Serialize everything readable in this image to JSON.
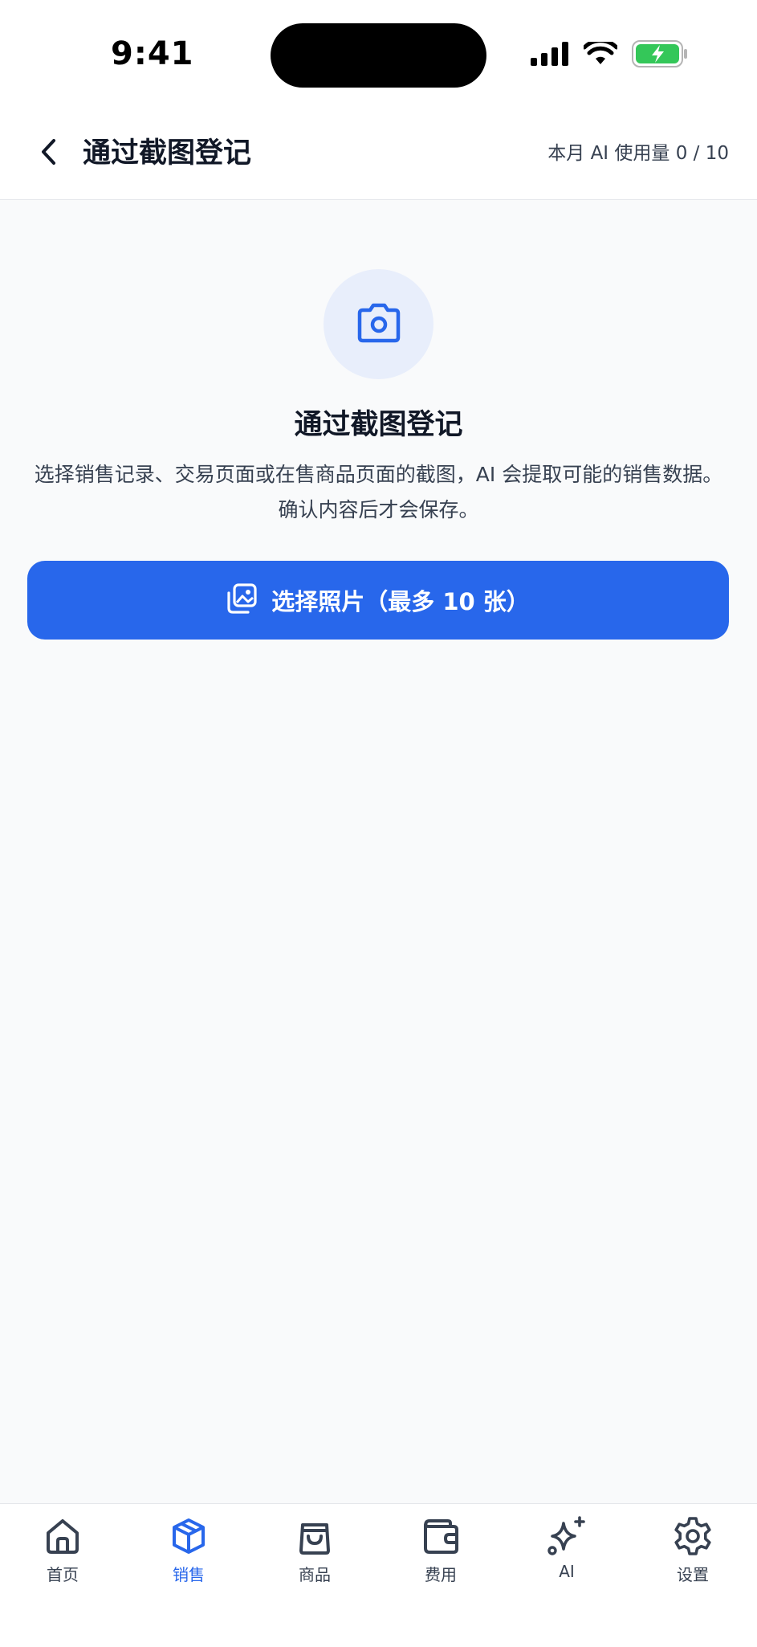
{
  "status_bar": {
    "time": "9:41"
  },
  "header": {
    "title": "通过截图登记",
    "usage": "本月 AI 使用量 0 / 10"
  },
  "main": {
    "hero_title": "通过截图登记",
    "description": "选择销售记录、交易页面或在售商品页面的截图，AI 会提取可能的销售数据。确认内容后才会保存。",
    "select_button_label": "选择照片（最多 10 张）"
  },
  "tabs": [
    {
      "label": "首页",
      "icon": "home-icon",
      "active": false
    },
    {
      "label": "销售",
      "icon": "box-icon",
      "active": true
    },
    {
      "label": "商品",
      "icon": "shopping-bag-icon",
      "active": false
    },
    {
      "label": "费用",
      "icon": "wallet-icon",
      "active": false
    },
    {
      "label": "AI",
      "icon": "sparkles-icon",
      "active": false
    },
    {
      "label": "设置",
      "icon": "gear-icon",
      "active": false
    }
  ],
  "colors": {
    "accent": "#2867eb",
    "background": "#f9fafb",
    "icon_circle": "#e8eefb",
    "battery": "#34c759"
  }
}
